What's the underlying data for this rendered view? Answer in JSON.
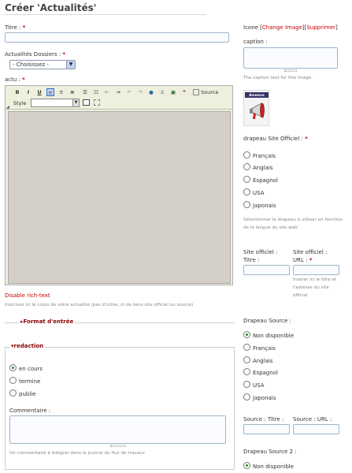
{
  "page": {
    "title": "Créer 'Actualités'"
  },
  "left": {
    "titre_label": "Titre :",
    "titre_value": "",
    "dossiers_label": "Actualités Dossiers :",
    "dossiers_selected": "- Choisissez -",
    "actu_label": "actu :",
    "toolbar": {
      "bold": "B",
      "italic": "I",
      "underline": "U",
      "style_label": "Style",
      "source_label": "Source"
    },
    "disable_rich_text": "Disable rich-text",
    "editor_help": "Inscrivez ici le corps de votre actualité (pas d'icône, ni de liens site officiel ou source)",
    "format_entree": "Format d'entrée",
    "redaction": {
      "legend": "redaction",
      "options": [
        "en cours",
        "termine",
        "publie"
      ],
      "selected": "en cours",
      "commentaire_label": "Commentaire :",
      "commentaire_help": "Un commentaire à intégrer dans le journal du flux de travaux"
    }
  },
  "right": {
    "icone_label": "Icone",
    "change_image": "Change Image",
    "supprimer": "Supprimer",
    "caption_label": "caption :",
    "caption_help": "The caption text for this image.",
    "icon_caption_text": "Annonce",
    "drapeau_label": "drapeau Site Officiel :",
    "drapeau_options": [
      "Français",
      "Anglais",
      "Espagnol",
      "USA",
      "Japonais"
    ],
    "drapeau_help": "Sélectionner le drapeau à utiliser en fonction de la langue du site web",
    "site_titre_label_1": "Site officiel :",
    "site_titre_label_2": "Titre :",
    "site_url_label_1": "Site officiel :",
    "site_url_label_2": "URL :",
    "site_url_help": "Insérer ici le titre et l'adresse du site officiel",
    "source_label": "Drapeau Source :",
    "source_options": [
      "Non disponible",
      "Français",
      "Anglais",
      "Espagnol",
      "USA",
      "Japonais"
    ],
    "source_selected": "Non disponible",
    "source_titre_label": "Source : Titre :",
    "source_url_label": "Source : URL :",
    "source2_label": "Drapeau Source 2 :",
    "source2_first": "Non disponible"
  },
  "colors": {
    "accent_red": "#cc0000",
    "border": "#9fb4c8",
    "editor_bg": "#d4d0c8"
  }
}
